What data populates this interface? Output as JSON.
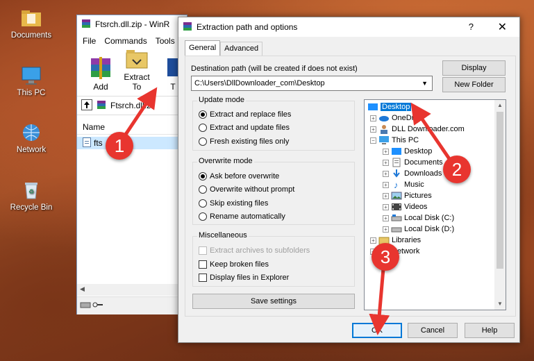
{
  "desktop": {
    "icons": [
      {
        "label": "Documents"
      },
      {
        "label": "This PC"
      },
      {
        "label": "Network"
      },
      {
        "label": "Recycle Bin"
      }
    ]
  },
  "winrar": {
    "title": "Ftsrch.dll.zip - WinR",
    "menu": [
      "File",
      "Commands",
      "Tools"
    ],
    "toolbar": [
      "Add",
      "Extract To",
      "T"
    ],
    "address": "Ftsrch.dll.z",
    "column_name": "Name",
    "row_file": "fts"
  },
  "dialog": {
    "title": "Extraction path and options",
    "help": "?",
    "close": "✕",
    "tabs": [
      "General",
      "Advanced"
    ],
    "dest_label": "Destination path (will be created if does not exist)",
    "dest_value": "C:\\Users\\DllDownloader_com\\Desktop",
    "display_button": "Display",
    "new_folder_button": "New Folder",
    "update_mode": {
      "title": "Update mode",
      "options": [
        "Extract and replace files",
        "Extract and update files",
        "Fresh existing files only"
      ],
      "selected": 0
    },
    "overwrite_mode": {
      "title": "Overwrite mode",
      "options": [
        "Ask before overwrite",
        "Overwrite without prompt",
        "Skip existing files",
        "Rename automatically"
      ],
      "selected": 0
    },
    "misc": {
      "title": "Miscellaneous",
      "options": [
        "Extract archives to subfolders",
        "Keep broken files",
        "Display files in Explorer"
      ]
    },
    "save_settings": "Save settings",
    "tree": [
      "Desktop",
      "OneDr",
      "DLL Downloader.com",
      "This PC",
      "Desktop",
      "Documents",
      "Downloads",
      "Music",
      "Pictures",
      "Videos",
      "Local Disk (C:)",
      "Local Disk (D:)",
      "Libraries",
      "Network"
    ],
    "ok": "OK",
    "cancel": "Cancel",
    "help_button": "Help"
  },
  "steps": [
    "1",
    "2",
    "3"
  ],
  "colors": {
    "accent": "#0078d7",
    "marker": "#e8352f"
  }
}
